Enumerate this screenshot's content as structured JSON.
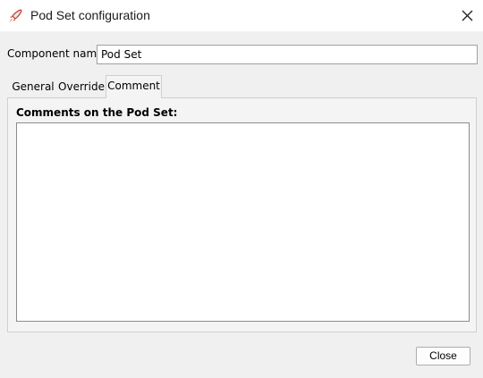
{
  "window": {
    "title": "Pod Set configuration",
    "app_icon": "rocket-icon",
    "close_icon": "close-icon"
  },
  "component_name": {
    "label": "Component name:",
    "value": "Pod Set"
  },
  "tabs": [
    {
      "label": "General",
      "selected": false
    },
    {
      "label": "Override",
      "selected": false
    },
    {
      "label": "Comment",
      "selected": true
    }
  ],
  "comment_panel": {
    "label": "Comments on the Pod Set:",
    "value": ""
  },
  "footer": {
    "close_label": "Close"
  },
  "colors": {
    "background": "#f0f0f0",
    "titlebar": "#ffffff",
    "rocket_red": "#c8372d"
  }
}
